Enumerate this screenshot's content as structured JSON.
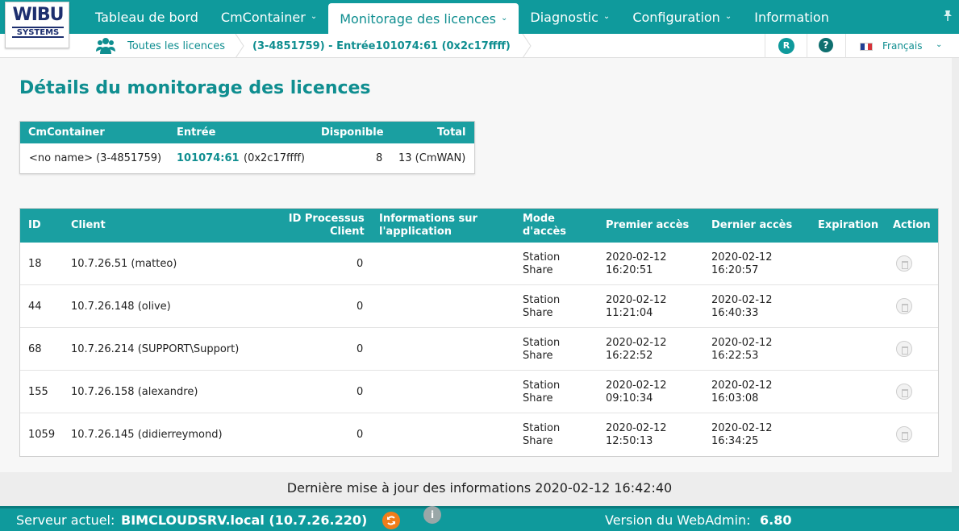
{
  "logo": {
    "top": "WIBU",
    "bottom": "SYSTEMS"
  },
  "nav": {
    "items": [
      {
        "label": "Tableau de bord",
        "has_menu": false
      },
      {
        "label": "CmContainer",
        "has_menu": true
      },
      {
        "label": "Monitorage des licences",
        "has_menu": true,
        "active": true
      },
      {
        "label": "Diagnostic",
        "has_menu": true
      },
      {
        "label": "Configuration",
        "has_menu": true
      },
      {
        "label": "Information",
        "has_menu": false
      }
    ],
    "chevron": "⌄",
    "pin_icon": "pushpin-icon"
  },
  "breadcrumb": {
    "icon": "users-icon",
    "root": "Toutes les licences",
    "current": "(3-4851759) - Entrée101074:61 (0x2c17ffff)"
  },
  "header_right": {
    "user_badge": "R",
    "help": "?",
    "language": "Français"
  },
  "page": {
    "title": "Détails du monitorage des licences"
  },
  "summary": {
    "headers": {
      "container": "CmContainer",
      "entry": "Entrée",
      "available": "Disponible",
      "total": "Total"
    },
    "row": {
      "container": "<no name> (3-4851759)",
      "entry_link": "101074:61",
      "entry_code": "(0x2c17ffff)",
      "available": "8",
      "total": "13 (CmWAN)"
    }
  },
  "table": {
    "headers": {
      "id": "ID",
      "client": "Client",
      "pid_1": "ID Processus",
      "pid_2": "Client",
      "appinfo_1": "Informations sur",
      "appinfo_2": "l'application",
      "mode_1": "Mode",
      "mode_2": "d'accès",
      "first": "Premier accès",
      "last": "Dernier accès",
      "expiration": "Expiration",
      "action": "Action"
    },
    "rows": [
      {
        "id": "18",
        "client": "10.7.26.51 (matteo)",
        "pid": "0",
        "mode_1": "Station",
        "mode_2": "Share",
        "first_date": "2020-02-12",
        "first_time": "16:20:51",
        "last_date": "2020-02-12",
        "last_time": "16:20:57"
      },
      {
        "id": "44",
        "client": "10.7.26.148 (olive)",
        "pid": "0",
        "mode_1": "Station",
        "mode_2": "Share",
        "first_date": "2020-02-12",
        "first_time": "11:21:04",
        "last_date": "2020-02-12",
        "last_time": "16:40:33"
      },
      {
        "id": "68",
        "client": "10.7.26.214 (SUPPORT\\Support)",
        "pid": "0",
        "mode_1": "Station",
        "mode_2": "Share",
        "first_date": "2020-02-12",
        "first_time": "16:22:52",
        "last_date": "2020-02-12",
        "last_time": "16:22:53"
      },
      {
        "id": "155",
        "client": "10.7.26.158 (alexandre)",
        "pid": "0",
        "mode_1": "Station",
        "mode_2": "Share",
        "first_date": "2020-02-12",
        "first_time": "09:10:34",
        "last_date": "2020-02-12",
        "last_time": "16:03:08"
      },
      {
        "id": "1059",
        "client": "10.7.26.145 (didierreymond)",
        "pid": "0",
        "mode_1": "Station",
        "mode_2": "Share",
        "first_date": "2020-02-12",
        "first_time": "12:50:13",
        "last_date": "2020-02-12",
        "last_time": "16:34:25"
      }
    ]
  },
  "footer": {
    "update_text": "Dernière mise à jour des informations 2020-02-12 16:42:40",
    "server_label": "Serveur actuel:",
    "server_value": "BIMCLOUDSRV.local (10.7.26.220)",
    "version_label": "Version du WebAdmin:",
    "version_value": "6.80",
    "info_glyph": "i"
  },
  "colors": {
    "accent": "#0f9a9c",
    "link": "#0f8e90",
    "sync": "#f07d1a"
  }
}
